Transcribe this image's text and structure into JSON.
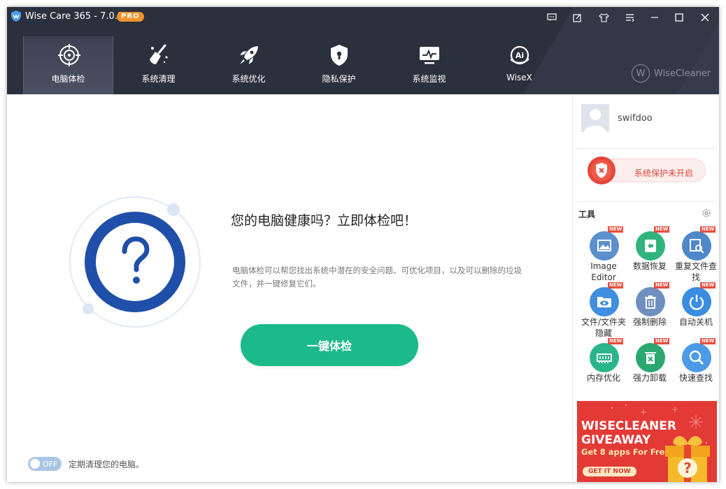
{
  "window": {
    "title": "Wise Care 365 - 7.0.9",
    "badge": "PRO"
  },
  "nav": {
    "items": [
      {
        "label": "电脑体检",
        "icon": "crosshair-icon",
        "active": true
      },
      {
        "label": "系统清理",
        "icon": "broom-icon",
        "active": false
      },
      {
        "label": "系统优化",
        "icon": "rocket-icon",
        "active": false
      },
      {
        "label": "隐私保护",
        "icon": "shield-lock-icon",
        "active": false
      },
      {
        "label": "系统监视",
        "icon": "monitor-icon",
        "active": false
      },
      {
        "label": "WiseX",
        "icon": "ai-icon",
        "active": false
      }
    ],
    "brand": "WiseCleaner"
  },
  "main": {
    "headline": "您的电脑健康吗？立即体检吧！",
    "description": "电脑体检可以帮您找出系统中潜在的安全问题、可优化项目，以及可以删除的垃圾文件，并一键修复它们。",
    "scan_button": "一键体检",
    "toggle_state": "OFF",
    "toggle_label": "定期清理您的电脑。"
  },
  "sidebar": {
    "username": "swifdoo",
    "protection_status": "系统保护未开启",
    "tools_title": "工具",
    "tools": [
      {
        "label": "Image Editor",
        "icon": "image-icon",
        "color": "#5a8fd8",
        "new": true
      },
      {
        "label": "数据恢复",
        "icon": "recovery-icon",
        "color": "#2fb47c",
        "new": true
      },
      {
        "label": "重复文件查找",
        "icon": "duplicate-file-icon",
        "color": "#4f8fd6",
        "new": true
      },
      {
        "label": "文件/文件夹隐藏",
        "icon": "hide-folder-icon",
        "color": "#3f8ee0",
        "new": true
      },
      {
        "label": "强制删除",
        "icon": "trash-icon",
        "color": "#6c8fc2",
        "new": true
      },
      {
        "label": "自动关机",
        "icon": "power-icon",
        "color": "#3b8de0",
        "new": true
      },
      {
        "label": "内存优化",
        "icon": "memory-icon",
        "color": "#2bb58a",
        "new": true
      },
      {
        "label": "强力卸载",
        "icon": "uninstall-icon",
        "color": "#2aa870",
        "new": true
      },
      {
        "label": "快速查找",
        "icon": "search-icon",
        "color": "#4d9ae6",
        "new": true
      }
    ],
    "new_tag": "NEW",
    "ad": {
      "line1": "WISECLEANER",
      "line2": "GIVEAWAY",
      "line3": "Get 8 apps For Free",
      "button": "GET IT NOW"
    }
  },
  "colors": {
    "header_bg": "#2b303d",
    "accent_green": "#1cba8a",
    "circle_blue": "#1f4fa8",
    "warning_red": "#d94a3d"
  }
}
